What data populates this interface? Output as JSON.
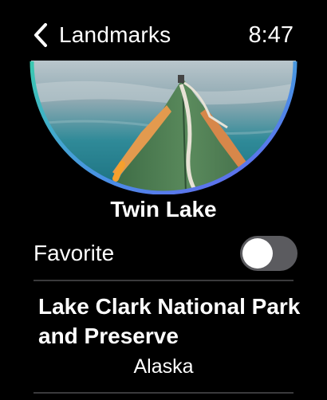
{
  "nav": {
    "back_label": "Landmarks",
    "time": "8:47"
  },
  "landmark": {
    "name": "Twin Lake",
    "park": "Lake Clark National Park and Preserve",
    "state": "Alaska",
    "favorite_label": "Favorite",
    "favorite_on": false
  },
  "colors": {
    "background": "#000000",
    "ring_start": "#3bc9b0",
    "ring_end": "#6b5cf0",
    "toggle_off": "#5b5b5f",
    "divider": "#3a3a3c"
  },
  "icons": {
    "back": "chevron-left-icon"
  }
}
